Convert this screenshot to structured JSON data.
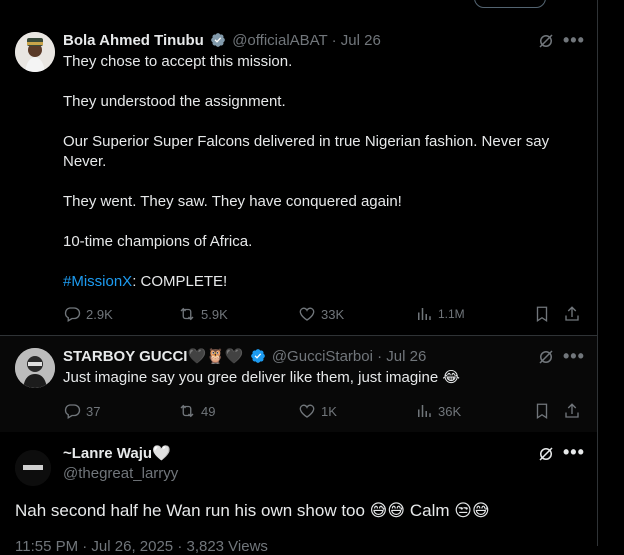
{
  "tweets": [
    {
      "name": "Bola Ahmed Tinubu",
      "handle": "@officialABAT",
      "date": "· Jul 26",
      "paragraphs": [
        "They chose to accept this mission.",
        "They understood the assignment.",
        "Our Superior Super Falcons delivered in true Nigerian fashion. Never say Never.",
        "They went. They saw. They have conquered again!",
        "10-time champions of Africa."
      ],
      "hashtag": "#MissionX",
      "hashtag_rest": ": COMPLETE!",
      "replies": "2.9K",
      "retweets": "5.9K",
      "likes": "33K",
      "views": "1.1M"
    },
    {
      "name": "STARBOY GUCCI🖤🦉🖤",
      "handle": "@GucciStarboi",
      "date": "· Jul 26",
      "text": "Just imagine say you gree deliver like them, just imagine 😂",
      "replies": "37",
      "retweets": "49",
      "likes": "1K",
      "views": "36K"
    },
    {
      "name": "~Lanre Waju🤍",
      "handle": "@thegreat_larryy",
      "text": "Nah second half he Wan run his own show too 😅😅 Calm 😒😅",
      "meta": "11:55 PM · Jul 26, 2025 · 3,823 Views"
    }
  ],
  "icons": {
    "verified": "verified-badge-icon",
    "grok": "grok-icon",
    "more": "more-icon",
    "reply": "reply-icon",
    "retweet": "retweet-icon",
    "like": "like-icon",
    "views": "views-icon",
    "bookmark": "bookmark-icon",
    "share": "share-icon"
  },
  "colors": {
    "background": "#000000",
    "text": "#e7e9ea",
    "secondary": "#71767b",
    "link": "#1d9bf0",
    "verified": "#1d9bf0"
  },
  "more_glyph": "•••"
}
